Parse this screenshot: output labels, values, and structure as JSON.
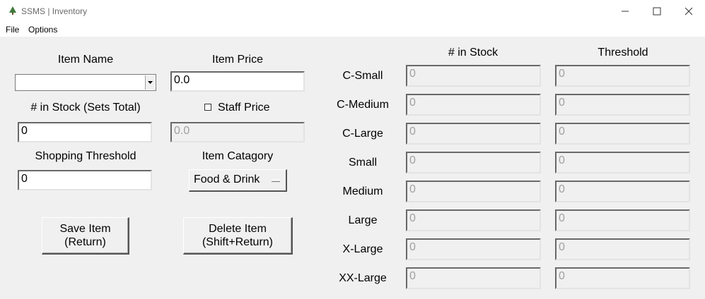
{
  "window": {
    "title": "SSMS | Inventory"
  },
  "menu": {
    "file": "File",
    "options": "Options"
  },
  "form": {
    "item_name": {
      "label": "Item Name",
      "value": ""
    },
    "item_price": {
      "label": "Item Price",
      "value": "0.0"
    },
    "stock_total": {
      "label": "# in Stock (Sets Total)",
      "value": "0"
    },
    "staff_price": {
      "label": "Staff Price",
      "checked": false,
      "value": "0.0"
    },
    "shopping_threshold": {
      "label": "Shopping Threshold",
      "value": "0"
    },
    "item_category": {
      "label": "Item Catagory",
      "value": "Food & Drink"
    },
    "save_button": {
      "line1": "Save Item",
      "line2": "(Return)"
    },
    "delete_button": {
      "line1": "Delete Item",
      "line2": "(Shift+Return)"
    }
  },
  "sizes": {
    "stock_header": "# in Stock",
    "threshold_header": "Threshold",
    "rows": [
      {
        "label": "C-Small",
        "stock": "0",
        "threshold": "0"
      },
      {
        "label": "C-Medium",
        "stock": "0",
        "threshold": "0"
      },
      {
        "label": "C-Large",
        "stock": "0",
        "threshold": "0"
      },
      {
        "label": "Small",
        "stock": "0",
        "threshold": "0"
      },
      {
        "label": "Medium",
        "stock": "0",
        "threshold": "0"
      },
      {
        "label": "Large",
        "stock": "0",
        "threshold": "0"
      },
      {
        "label": "X-Large",
        "stock": "0",
        "threshold": "0"
      },
      {
        "label": "XX-Large",
        "stock": "0",
        "threshold": "0"
      }
    ]
  },
  "icons": {
    "app": "tree-icon",
    "minimize": "minimize-icon",
    "maximize": "maximize-icon",
    "close": "close-icon",
    "dropdown": "chevron-down-icon"
  }
}
